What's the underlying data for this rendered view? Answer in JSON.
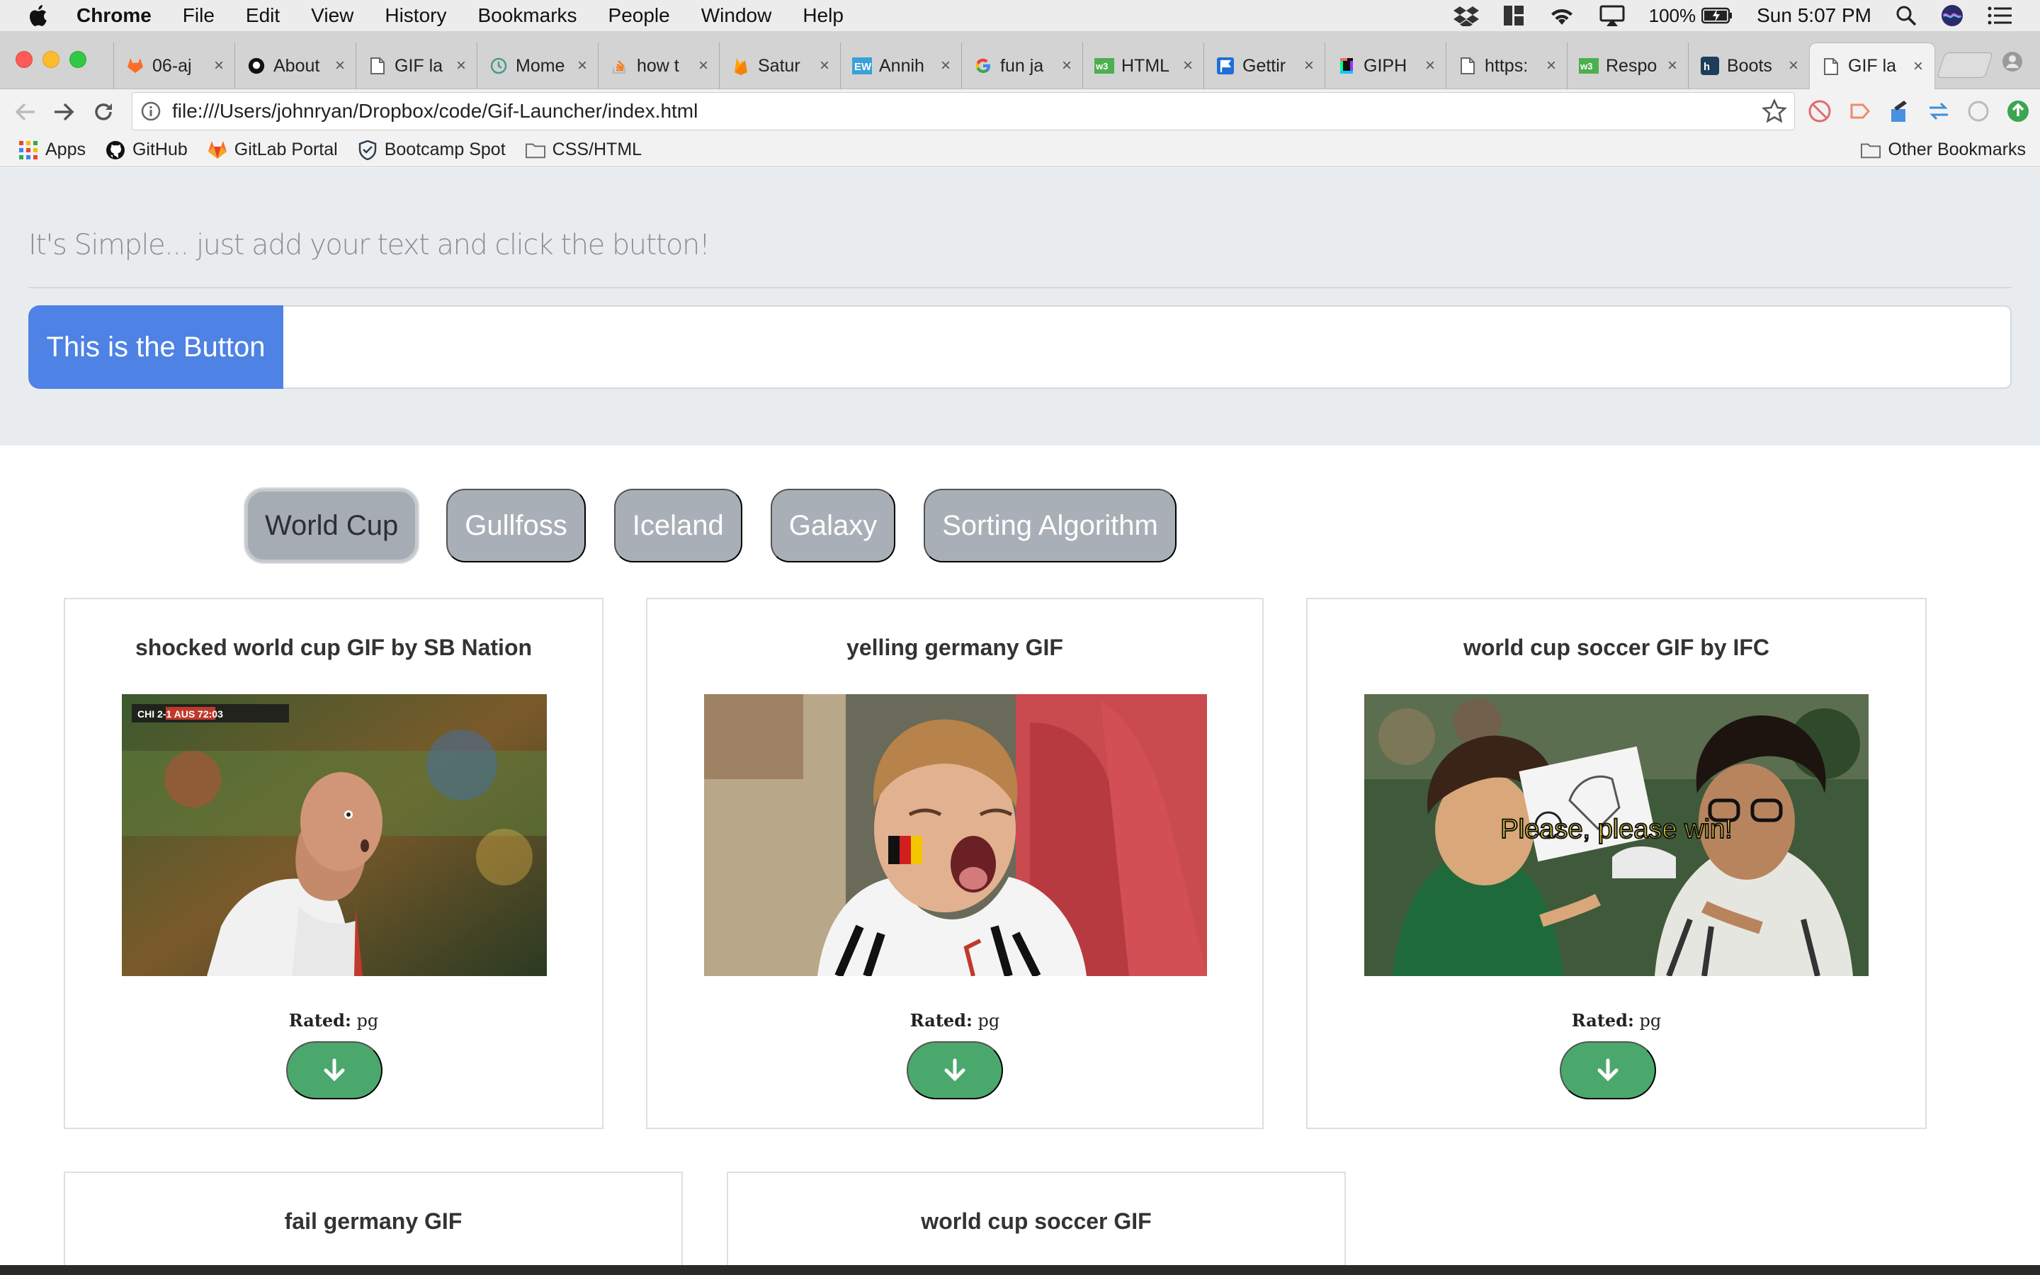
{
  "menubar": {
    "app_name": "Chrome",
    "items": [
      "File",
      "Edit",
      "View",
      "History",
      "Bookmarks",
      "People",
      "Window",
      "Help"
    ],
    "battery": "100%",
    "clock": "Sun 5:07 PM"
  },
  "tabs": [
    {
      "title": "06-aj",
      "icon": "gitlab-icon"
    },
    {
      "title": "About",
      "icon": "github-icon"
    },
    {
      "title": "GIF la",
      "icon": "page-icon"
    },
    {
      "title": "Mome",
      "icon": "clock-icon"
    },
    {
      "title": "how t",
      "icon": "stackoverflow-icon"
    },
    {
      "title": "Satur",
      "icon": "firebase-icon"
    },
    {
      "title": "Annih",
      "icon": "ew-icon"
    },
    {
      "title": "fun ja",
      "icon": "google-icon"
    },
    {
      "title": "HTML",
      "icon": "w3-icon"
    },
    {
      "title": "Gettir",
      "icon": "flag-icon"
    },
    {
      "title": "GIPH",
      "icon": "giphy-icon"
    },
    {
      "title": "https:",
      "icon": "page-icon"
    },
    {
      "title": "Respo",
      "icon": "w3-icon"
    },
    {
      "title": "Boots",
      "icon": "hackernoon-icon"
    },
    {
      "title": "GIF la",
      "icon": "page-icon",
      "active": true
    }
  ],
  "address": {
    "url": "file:///Users/johnryan/Dropbox/code/Gif-Launcher/index.html"
  },
  "bookmarks": {
    "items": [
      "Apps",
      "GitHub",
      "GitLab Portal",
      "Bootcamp Spot",
      "CSS/HTML"
    ],
    "other": "Other Bookmarks"
  },
  "jumbotron": {
    "lead": "It's Simple... just add your text and click the button!",
    "button_label": "This is the Button",
    "input_value": ""
  },
  "topics": [
    "World Cup",
    "Gullfoss",
    "Iceland",
    "Galaxy",
    "Sorting Algorithm"
  ],
  "selected_topic": "World Cup",
  "gifs": [
    {
      "title": "shocked world cup GIF by SB Nation",
      "rating_label": "Rated:",
      "rating": "pg",
      "caption": "",
      "score": "CHI 2-1 AUS 72:03"
    },
    {
      "title": "yelling germany GIF",
      "rating_label": "Rated:",
      "rating": "pg",
      "caption": ""
    },
    {
      "title": "world cup soccer GIF by IFC",
      "rating_label": "Rated:",
      "rating": "pg",
      "caption": "Please, please win!"
    },
    {
      "title": "fail germany GIF"
    },
    {
      "title": "world cup soccer GIF"
    }
  ],
  "colors": {
    "primary": "#4e82e4",
    "topic_button": "#a9afb6",
    "download_button": "#4ba86c",
    "jumbotron_bg": "#e9ecef"
  }
}
